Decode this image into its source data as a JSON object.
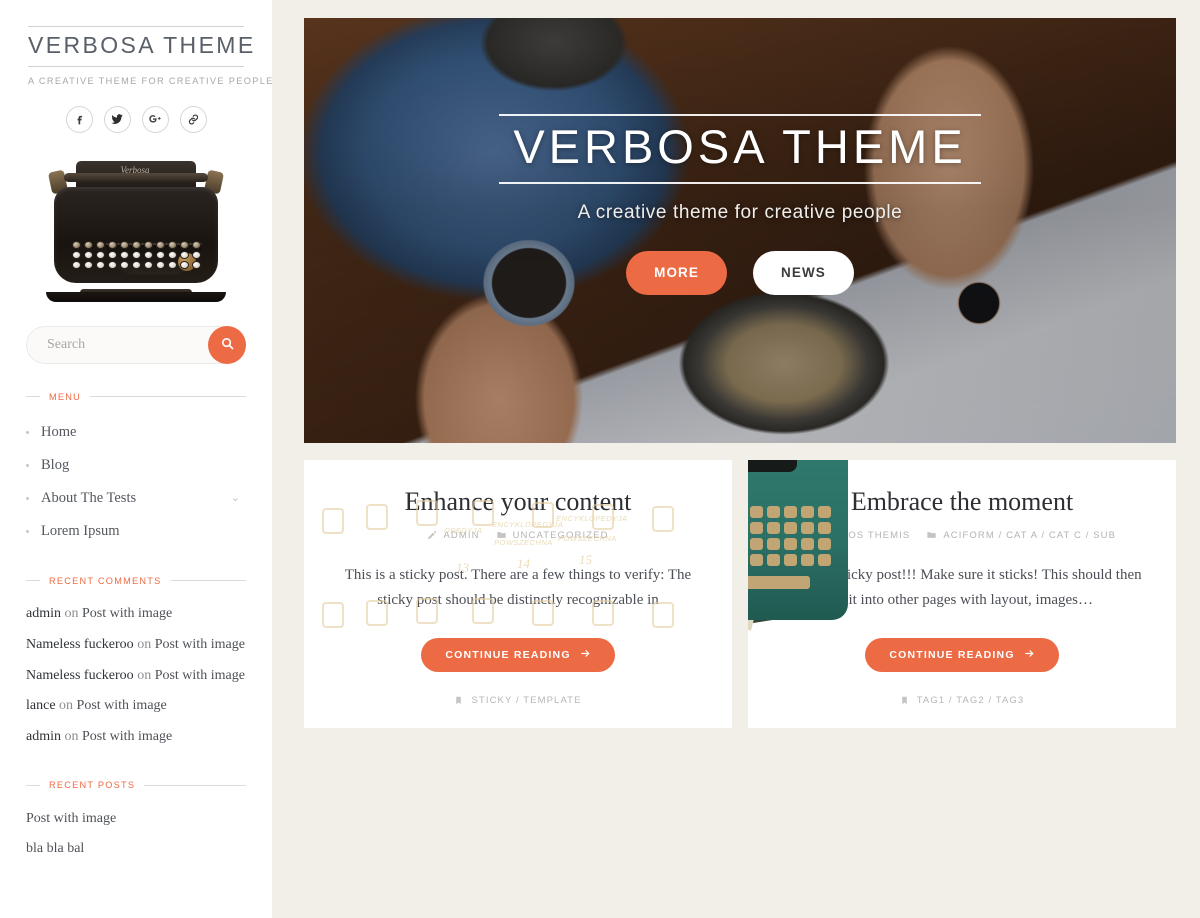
{
  "colors": {
    "accent": "#ec6b45",
    "sidebar_bg": "#ffffff",
    "page_bg": "#f2efe9",
    "card_bg": "#ffffff",
    "heading_text": "#2d2f33",
    "muted_text": "#b6b3b0"
  },
  "sidebar": {
    "site_title": "VERBOSA THEME",
    "tagline": "A CREATIVE THEME FOR CREATIVE PEOPLE",
    "social": [
      {
        "name": "facebook-icon",
        "label": "Facebook"
      },
      {
        "name": "twitter-icon",
        "label": "Twitter"
      },
      {
        "name": "google-plus-icon",
        "label": "Google Plus"
      },
      {
        "name": "link-icon",
        "label": "Link"
      }
    ],
    "logo_image_alt": "Vintage black typewriter",
    "search": {
      "placeholder": "Search",
      "value": "",
      "button_icon": "search-icon"
    },
    "menu_widget": {
      "title": "MENU",
      "items": [
        {
          "label": "Home",
          "has_submenu": false
        },
        {
          "label": "Blog",
          "has_submenu": false
        },
        {
          "label": "About The Tests",
          "has_submenu": true,
          "chevron": "⌄"
        },
        {
          "label": "Lorem Ipsum",
          "has_submenu": false
        }
      ]
    },
    "recent_comments_widget": {
      "title": "RECENT COMMENTS",
      "items": [
        {
          "author": "admin",
          "on": " on ",
          "post": "Post with image"
        },
        {
          "author": "Nameless fuckeroo",
          "on": " on ",
          "post": "Post with image"
        },
        {
          "author": "Nameless fuckeroo",
          "on": " on ",
          "post": "Post with image"
        },
        {
          "author": "lance",
          "on": " on ",
          "post": "Post with image"
        },
        {
          "author": "admin",
          "on": " on ",
          "post": "Post with image"
        }
      ]
    },
    "recent_posts_widget": {
      "title": "RECENT POSTS",
      "items": [
        {
          "label": "Post with image"
        },
        {
          "label": "bla bla bal"
        }
      ]
    }
  },
  "hero": {
    "image_alt": "Overhead photo of hands holding coffee cup, teapot, bowl of cereal and magazine on a wooden table",
    "title": "VERBOSA THEME",
    "subtitle": "A creative theme for creative people",
    "primary_button": "MORE",
    "secondary_button": "NEWS"
  },
  "posts": [
    {
      "image_alt": "Row of antique encyclopedia book spines",
      "title": "Enhance your content",
      "author_icon": "pencil-icon",
      "author": "ADMIN",
      "category_icon": "folder-icon",
      "categories": "UNCATEGORIZED",
      "excerpt": "This is a sticky post. There are a few things to verify: The sticky post should be distinctly recognizable in",
      "read_more": "CONTINUE READING",
      "read_more_icon": "arrow-right-icon",
      "tags_icon": "tag-icon",
      "tags": "STICKY / TEMPLATE"
    },
    {
      "image_alt": "Teal vintage typewriter on wooden planks with a green book and cream paper",
      "title": "Embrace the moment",
      "author_icon": "pencil-icon",
      "author": "DEMOS THEMIS",
      "category_icon": "folder-icon",
      "categories": "ACIFORM / CAT A / CAT C / SUB",
      "excerpt": "This is a sticky post!!! Make sure it sticks! This should then split into other pages with layout, images…",
      "read_more": "CONTINUE READING",
      "read_more_icon": "arrow-right-icon",
      "tags_icon": "tag-icon",
      "tags": "TAG1 / TAG2 / TAG3"
    }
  ]
}
